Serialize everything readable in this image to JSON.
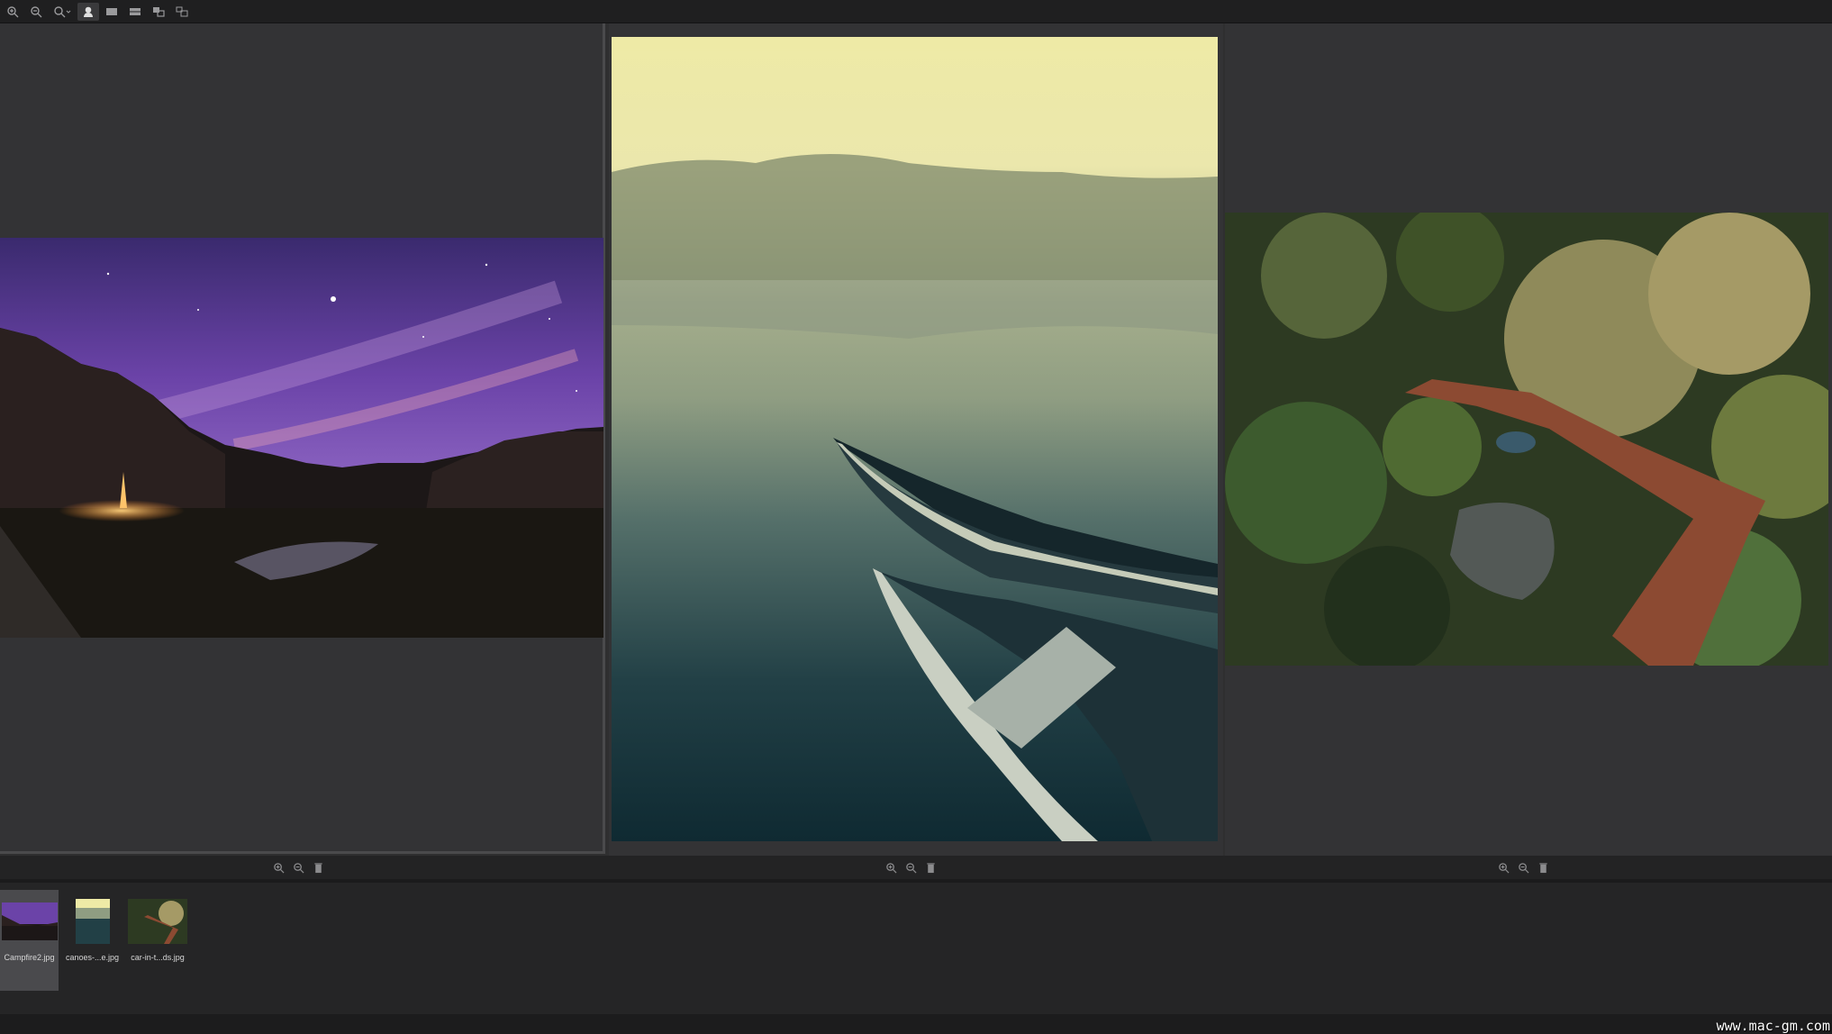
{
  "toolbar": {
    "buttons": [
      {
        "icon": "zoom-in-icon"
      },
      {
        "icon": "zoom-out-icon"
      },
      {
        "icon": "zoom-dropdown-icon"
      },
      {
        "icon": "compare-icon",
        "active": true
      },
      {
        "icon": "single-view-icon"
      },
      {
        "icon": "split-view-icon"
      },
      {
        "icon": "grid-view-icon"
      },
      {
        "icon": "settings-icon"
      }
    ]
  },
  "panes": [
    {
      "image": "campfire-night-sky",
      "footer_icons": [
        "zoom-in-icon",
        "zoom-out-icon",
        "trash-icon"
      ]
    },
    {
      "image": "canoes-misty-lake",
      "footer_icons": [
        "zoom-in-icon",
        "zoom-out-icon",
        "trash-icon"
      ]
    },
    {
      "image": "car-in-forest-aerial",
      "footer_icons": [
        "zoom-in-icon",
        "zoom-out-icon",
        "trash-icon"
      ]
    }
  ],
  "filmstrip": {
    "items": [
      {
        "label": "Campfire2.jpg",
        "selected": true
      },
      {
        "label": "canoes-...e.jpg",
        "selected": false
      },
      {
        "label": "car-in-t...ds.jpg",
        "selected": false
      }
    ]
  },
  "watermark": "www.mac-gm.com",
  "colors": {
    "toolbar_bg": "#1f1f20",
    "pane_bg": "#333335",
    "filmstrip_bg": "#252526",
    "selected_thumb": "#4a4a4d"
  }
}
